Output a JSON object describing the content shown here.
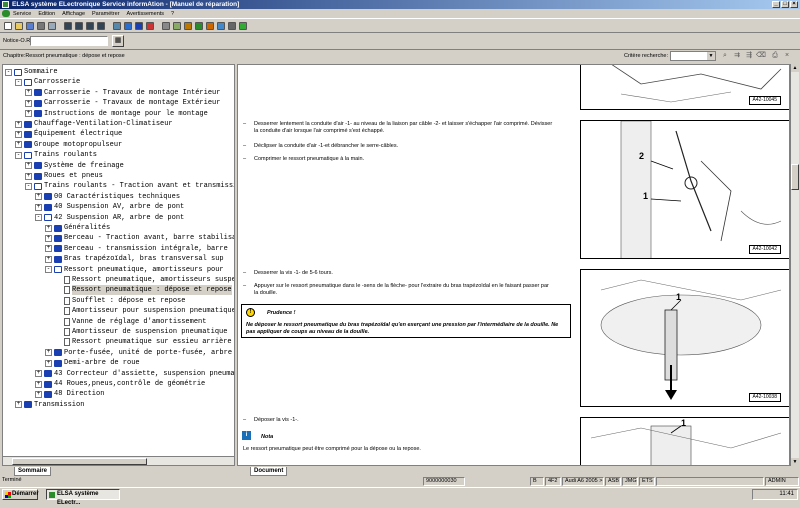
{
  "window": {
    "title": "ELSA système ELectronique Service informAtion - [Manuel de réparation]"
  },
  "menu": [
    "Service",
    "Edition",
    "Affichage",
    "Paramétrer",
    "Avertissements",
    "?"
  ],
  "toolbar_icons": [
    "new-icon",
    "open-icon",
    "save-icon",
    "print-icon",
    "preview-icon",
    "first-icon",
    "prev-icon",
    "next-icon",
    "last-icon",
    "search-icon",
    "info-icon",
    "book-icon",
    "bookmark-icon",
    "settings-icon",
    "tools-icon",
    "help-icon",
    "home-icon",
    "car-icon",
    "chart-icon",
    "export-icon",
    "sync-icon"
  ],
  "notice": {
    "label": "Notice-O.R.:",
    "value": ""
  },
  "chapter": {
    "label": "Chapitre:Ressort pneumatique : dépose et repose",
    "search_label": "Critère recherche:",
    "search_value": ""
  },
  "tree": [
    {
      "level": 0,
      "exp": "-",
      "icon": "book-open",
      "label": "Sommaire"
    },
    {
      "level": 1,
      "exp": "-",
      "icon": "book-open",
      "label": "Carrosserie"
    },
    {
      "level": 2,
      "exp": "+",
      "icon": "book",
      "label": "Carrosserie - Travaux de montage Intérieur"
    },
    {
      "level": 2,
      "exp": "+",
      "icon": "book",
      "label": "Carrosserie - Travaux de montage Extérieur"
    },
    {
      "level": 2,
      "exp": "+",
      "icon": "book",
      "label": "Instructions de montage pour le montage"
    },
    {
      "level": 1,
      "exp": "+",
      "icon": "book",
      "label": "Chauffage-Ventilation-Climatiseur"
    },
    {
      "level": 1,
      "exp": "+",
      "icon": "book",
      "label": "Équipement électrique"
    },
    {
      "level": 1,
      "exp": "+",
      "icon": "book",
      "label": "Groupe motopropulseur"
    },
    {
      "level": 1,
      "exp": "-",
      "icon": "book-open",
      "label": "Trains roulants"
    },
    {
      "level": 2,
      "exp": "+",
      "icon": "book",
      "label": "Système de freinage"
    },
    {
      "level": 2,
      "exp": "+",
      "icon": "book",
      "label": "Roues et pneus"
    },
    {
      "level": 2,
      "exp": "-",
      "icon": "book-open",
      "label": "Trains roulants - Traction avant et transmission"
    },
    {
      "level": 3,
      "exp": "+",
      "icon": "book",
      "label": "00 Caractéristiques techniques"
    },
    {
      "level": 3,
      "exp": "+",
      "icon": "book",
      "label": "40 Suspension AV, arbre de pont"
    },
    {
      "level": 3,
      "exp": "-",
      "icon": "book-open",
      "label": "42 Suspension AR, arbre de pont"
    },
    {
      "level": 4,
      "exp": "+",
      "icon": "book",
      "label": "Généralités"
    },
    {
      "level": 4,
      "exp": "+",
      "icon": "book",
      "label": "Berceau - Traction avant, barre stabilisatrice"
    },
    {
      "level": 4,
      "exp": "+",
      "icon": "book",
      "label": "Berceau - transmission intégrale, barre"
    },
    {
      "level": 4,
      "exp": "+",
      "icon": "book",
      "label": "Bras trapézoïdal, bras transversal sup"
    },
    {
      "level": 4,
      "exp": "-",
      "icon": "book-open",
      "label": "Ressort pneumatique, amortisseurs pour"
    },
    {
      "level": 5,
      "exp": "",
      "icon": "page",
      "label": "Ressort pneumatique, amortisseurs suspe"
    },
    {
      "level": 5,
      "exp": "",
      "icon": "page",
      "label": "Ressort pneumatique : dépose et repose",
      "selected": true
    },
    {
      "level": 5,
      "exp": "",
      "icon": "page",
      "label": "Soufflet : dépose et repose"
    },
    {
      "level": 5,
      "exp": "",
      "icon": "page",
      "label": "Amortisseur pour suspension pneumatique"
    },
    {
      "level": 5,
      "exp": "",
      "icon": "page",
      "label": "Vanne de réglage d'amortissement"
    },
    {
      "level": 5,
      "exp": "",
      "icon": "page",
      "label": "Amortisseur de suspension pneumatique"
    },
    {
      "level": 5,
      "exp": "",
      "icon": "page",
      "label": "Ressort pneumatique sur essieu arrière"
    },
    {
      "level": 4,
      "exp": "+",
      "icon": "book",
      "label": "Porte-fusée, unité de porte-fusée, arbre"
    },
    {
      "level": 4,
      "exp": "+",
      "icon": "book",
      "label": "Demi-arbre de roue"
    },
    {
      "level": 3,
      "exp": "+",
      "icon": "book",
      "label": "43 Correcteur d'assiette, suspension pneumatique"
    },
    {
      "level": 3,
      "exp": "+",
      "icon": "book",
      "label": "44 Roues,pneus,contrôle de géométrie"
    },
    {
      "level": 3,
      "exp": "+",
      "icon": "book",
      "label": "48 Direction"
    },
    {
      "level": 1,
      "exp": "+",
      "icon": "book",
      "label": "Transmission"
    }
  ],
  "tabs": {
    "left": "Sommaire",
    "right": "Document"
  },
  "document": {
    "steps": [
      {
        "text": "Desserrer lentement la conduite d'air -1- au niveau de la liaison par câble -2- et laisser s'échapper l'air comprimé. Dévisser la conduite d'air lorsque l'air comprimé s'est échappé."
      },
      {
        "text": "Déclipser la conduite d'air -1-et débrancher le serre-câbles."
      },
      {
        "text": "Comprimer le ressort pneumatique à la main."
      },
      {
        "text": "Desserrer la vis -1- de 5-6 tours."
      },
      {
        "text": "Appuyer sur le ressort pneumatique dans le -sens de la flèche- pour l'extraire du bras trapézoïdal en le faisant passer par la douille."
      },
      {
        "text": "Déposer la vis -1-."
      }
    ],
    "caution": {
      "title": "Prudence !",
      "body": "Ne déposer le ressort pneumatique du bras trapézoïdal qu'en exerçant une pression par l'intermédiaire de la douille. Ne pas appliquer de coups au niveau de la douille."
    },
    "note": {
      "title": "Nota",
      "body": "Le ressort pneumatique peut être comprimé pour la dépose ou la repose."
    },
    "figures": [
      {
        "ref": "A42-10045",
        "labels": []
      },
      {
        "ref": "A42-10042",
        "labels": [
          "2",
          "1"
        ]
      },
      {
        "ref": "A42-10038",
        "labels": [
          "1"
        ]
      },
      {
        "ref": "",
        "labels": [
          "1"
        ]
      }
    ]
  },
  "status": {
    "text": "Terminé",
    "code": "9000000030",
    "b": "B",
    "f": "4F2",
    "model": "Audi A6 2005 >",
    "eng": "ASB",
    "jmg": "JMG",
    "ets": "ETS",
    "user": "ADMIN"
  },
  "taskbar": {
    "start": "Démarrer",
    "task": "ELSA système ELectr...",
    "time": "11:41"
  }
}
